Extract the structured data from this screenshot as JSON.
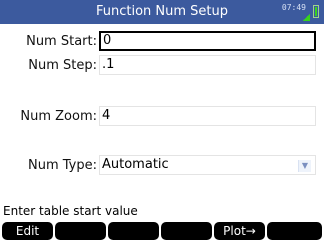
{
  "header": {
    "title": "Function Num Setup",
    "time": "07:49"
  },
  "fields": {
    "num_start": {
      "label": "Num Start:",
      "value": "0"
    },
    "num_step": {
      "label": "Num Step:",
      "value": ".1"
    },
    "num_zoom": {
      "label": "Num Zoom:",
      "value": "4"
    },
    "num_type": {
      "label": "Num Type:",
      "value": "Automatic"
    }
  },
  "help_text": "Enter table start value",
  "menu": {
    "edit": "Edit",
    "key2": "",
    "key3": "",
    "key4": "",
    "plot": "Plot→",
    "key6": ""
  },
  "colors": {
    "titlebar": "#3c5a9e",
    "battery": "#37d21e"
  }
}
